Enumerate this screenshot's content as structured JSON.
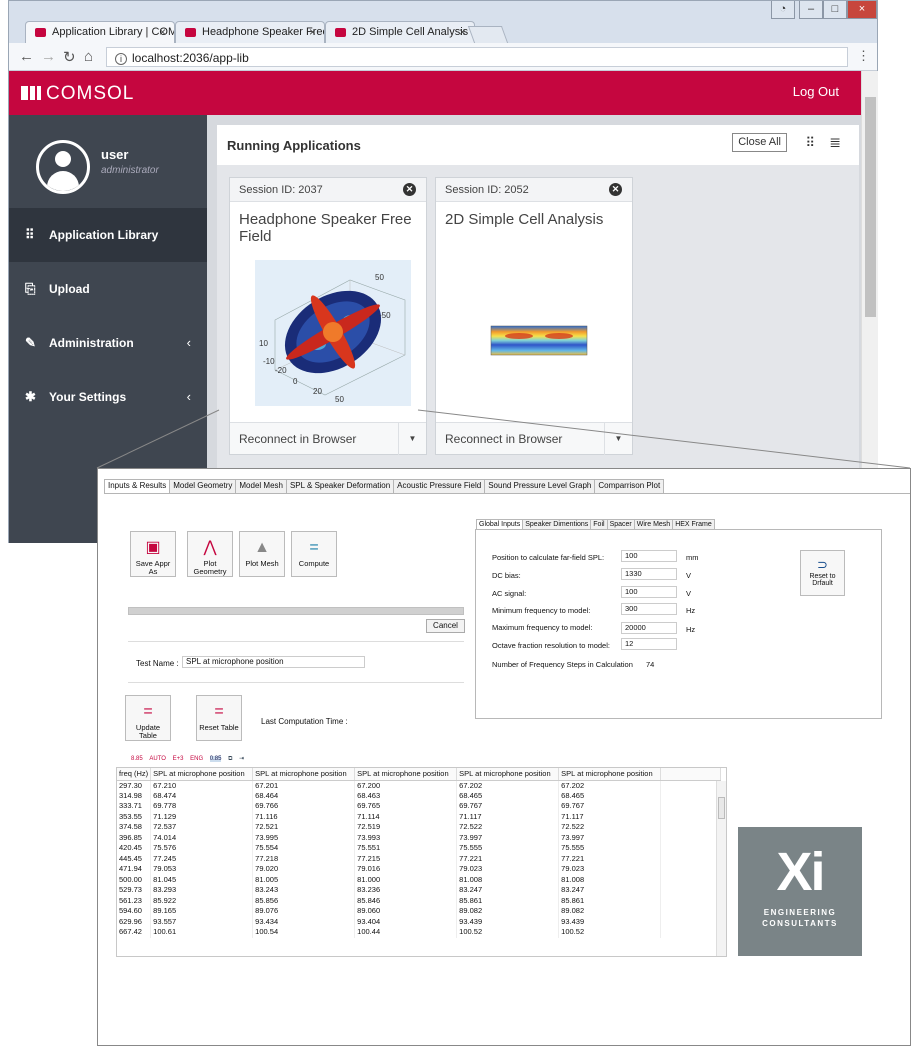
{
  "browser": {
    "tabs": [
      {
        "label": "Application Library | COM",
        "active": true
      },
      {
        "label": "Headphone Speaker Free",
        "active": false
      },
      {
        "label": "2D Simple Cell Analysis",
        "active": false
      }
    ],
    "url": "localhost:2036/app-lib"
  },
  "app": {
    "brand": "COMSOL",
    "logout": "Log Out",
    "accent": "#c5063f",
    "user": {
      "name": "user",
      "role": "administrator"
    },
    "nav": [
      {
        "label": "Application Library",
        "icon": "grid-icon",
        "active": true
      },
      {
        "label": "Upload",
        "icon": "upload-icon"
      },
      {
        "label": "Administration",
        "icon": "wrench-icon"
      },
      {
        "label": "Your Settings",
        "icon": "gear-icon"
      }
    ],
    "panel": {
      "title": "Running Applications",
      "close_all": "Close All"
    },
    "sessions": [
      {
        "session": "Session ID: 2037",
        "title": "Headphone Speaker Free Field",
        "action": "Reconnect in Browser"
      },
      {
        "session": "Session ID: 2052",
        "title": "2D Simple Cell Analysis",
        "action": "Reconnect in Browser"
      }
    ]
  },
  "desktop": {
    "main_tabs": [
      "Inputs & Results",
      "Model Geometry",
      "Model Mesh",
      "SPL & Speaker Deformation",
      "Acoustic Pressure Field",
      "Sound Pressure Level Graph",
      "Comparrison Plot"
    ],
    "buttons": {
      "save": "Save Appr As",
      "plot_geometry": "Plot Geometry",
      "plot_mesh": "Plot Mesh",
      "compute": "Compute",
      "cancel": "Cancel",
      "update_table": "Update Table",
      "reset_table": "Reset Table",
      "reset_default": "Reset to Drfault"
    },
    "test_name_label": "Test Name :",
    "test_name_value": "SPL at microphone position",
    "last_computation_label": "Last Computation Time :",
    "sub_tabs": [
      "Global Inputs",
      "Speaker Dimentions",
      "Foil",
      "Spacer",
      "Wire Mesh",
      "HEX Frame"
    ],
    "inputs": [
      {
        "label": "Position to calculate far-field SPL:",
        "value": "100",
        "unit": "mm"
      },
      {
        "label": "DC bias:",
        "value": "1330",
        "unit": "V"
      },
      {
        "label": "AC signal:",
        "value": "100",
        "unit": "V"
      },
      {
        "label": "Minimum frequency to model:",
        "value": "300",
        "unit": "Hz"
      },
      {
        "label": "Maximum frequency to model:",
        "value": "20000",
        "unit": "Hz"
      },
      {
        "label": "Octave fraction resolution to model:",
        "value": "12",
        "unit": ""
      }
    ],
    "freq_steps_label": "Number of Frequency Steps in Calculation",
    "freq_steps_value": "74",
    "table": {
      "headers": [
        "freq (Hz)",
        "SPL at microphone position",
        "SPL at microphone position",
        "SPL at microphone position",
        "SPL at microphone position",
        "SPL at microphone position"
      ],
      "rows": [
        [
          "297.30",
          "67.210",
          "67.201",
          "67.200",
          "67.202",
          "67.202"
        ],
        [
          "314.98",
          "68.474",
          "68.464",
          "68.463",
          "68.465",
          "68.465"
        ],
        [
          "333.71",
          "69.778",
          "69.766",
          "69.765",
          "69.767",
          "69.767"
        ],
        [
          "353.55",
          "71.129",
          "71.116",
          "71.114",
          "71.117",
          "71.117"
        ],
        [
          "374.58",
          "72.537",
          "72.521",
          "72.519",
          "72.522",
          "72.522"
        ],
        [
          "396.85",
          "74.014",
          "73.995",
          "73.993",
          "73.997",
          "73.997"
        ],
        [
          "420.45",
          "75.576",
          "75.554",
          "75.551",
          "75.555",
          "75.555"
        ],
        [
          "445.45",
          "77.245",
          "77.218",
          "77.215",
          "77.221",
          "77.221"
        ],
        [
          "471.94",
          "79.053",
          "79.020",
          "79.016",
          "79.023",
          "79.023"
        ],
        [
          "500.00",
          "81.045",
          "81.005",
          "81.000",
          "81.008",
          "81.008"
        ],
        [
          "529.73",
          "83.293",
          "83.243",
          "83.236",
          "83.247",
          "83.247"
        ],
        [
          "561.23",
          "85.922",
          "85.856",
          "85.846",
          "85.861",
          "85.861"
        ],
        [
          "594.60",
          "89.165",
          "89.076",
          "89.060",
          "89.082",
          "89.082"
        ],
        [
          "629.96",
          "93.557",
          "93.434",
          "93.404",
          "93.439",
          "93.439"
        ],
        [
          "667.42",
          "100.61",
          "100.54",
          "100.44",
          "100.52",
          "100.52"
        ]
      ]
    },
    "logo": {
      "mark": "Xi",
      "line1": "ENGINEERING",
      "line2": "CONSULTANTS"
    }
  }
}
